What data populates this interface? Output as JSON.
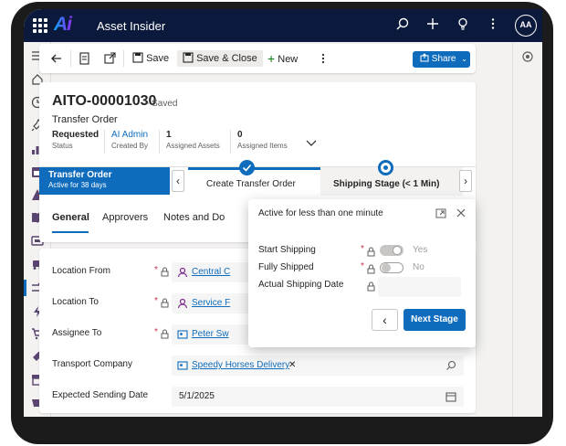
{
  "app": {
    "title": "Asset Insider",
    "logo_text": "Ai",
    "avatar_initials": "AA"
  },
  "toolbar": {
    "save_label": "Save",
    "save_close_label": "Save & Close",
    "new_label": "New",
    "share_label": "Share"
  },
  "record": {
    "id": "AITO-00001030",
    "saved_status": "- Saved",
    "entity": "Transfer Order",
    "fields": [
      {
        "value": "Requested",
        "label": "Status"
      },
      {
        "value": "AI Admin",
        "label": "Created By"
      },
      {
        "value": "1",
        "label": "Assigned Assets"
      },
      {
        "value": "0",
        "label": "Assigned Items"
      }
    ]
  },
  "bpf": {
    "active_title": "Transfer Order",
    "active_sub": "Active for 38 days",
    "stage1": "Create Transfer Order",
    "stage2": "Shipping Stage",
    "stage2_time": "(< 1 Min)"
  },
  "tabs": [
    "General",
    "Approvers",
    "Notes and Do"
  ],
  "form": {
    "location_from": {
      "label": "Location From",
      "value": "Central C"
    },
    "location_to": {
      "label": "Location To",
      "value": "Service F"
    },
    "assignee_to": {
      "label": "Assignee To",
      "value": "Peter Sw"
    },
    "transport_company": {
      "label": "Transport Company",
      "value": "Speedy Horses Delivery"
    },
    "expected_sending_date": {
      "label": "Expected Sending Date",
      "value": "5/1/2025"
    }
  },
  "popup": {
    "title": "Active for less than one minute",
    "start_shipping": {
      "label": "Start Shipping",
      "value": "Yes"
    },
    "fully_shipped": {
      "label": "Fully Shipped",
      "value": "No"
    },
    "actual_shipping_date": {
      "label": "Actual Shipping Date"
    },
    "next_stage_label": "Next Stage"
  },
  "colors": {
    "brand": "#0f6cbd",
    "topbar": "#0b1a3c",
    "nav_icon": "#5a4570",
    "required": "#c4314b"
  }
}
